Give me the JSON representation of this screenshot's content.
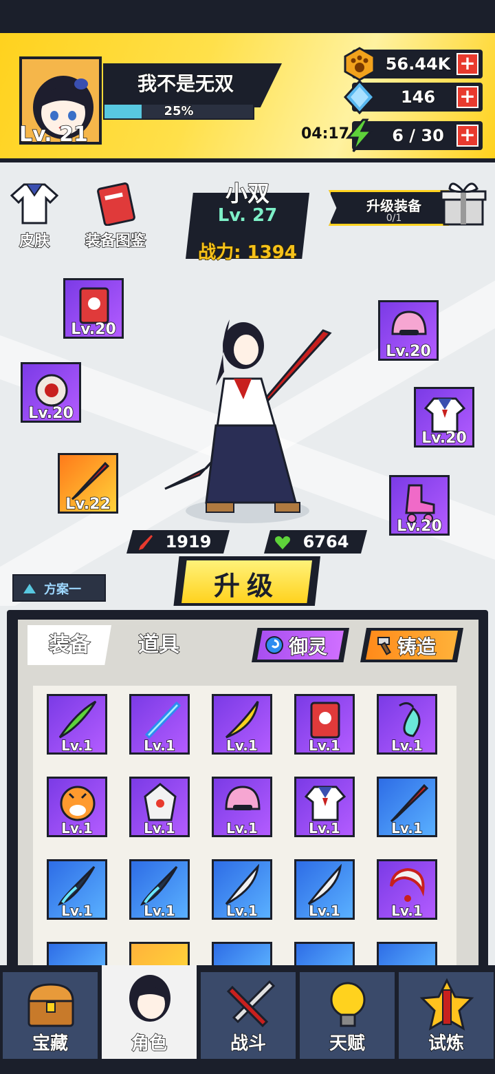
{
  "player": {
    "name": "我不是无双",
    "level": "Lv. 21",
    "exp_percent": "25%",
    "exp_fraction": 0.25
  },
  "resources": {
    "coins": "56.44K",
    "gems": "146",
    "stamina": "6 / 30",
    "stamina_timer": "04:17"
  },
  "side_buttons": {
    "skin": "皮肤",
    "codex": "装备图鉴"
  },
  "character": {
    "name": "小双",
    "level": "Lv. 27",
    "power": "战力: 1394",
    "attack": "1919",
    "hp": "6764"
  },
  "upgrade_equipment": {
    "title": "升级装备",
    "count": "0/1"
  },
  "equipped": [
    {
      "icon": "red-book-icon",
      "level": "Lv.20"
    },
    {
      "icon": "ring-icon",
      "level": "Lv.20"
    },
    {
      "icon": "red-sword-icon",
      "level": "Lv.22"
    },
    {
      "icon": "pink-helmet-icon",
      "level": "Lv.20"
    },
    {
      "icon": "uniform-icon",
      "level": "Lv.20"
    },
    {
      "icon": "roller-skate-icon",
      "level": "Lv.20"
    }
  ],
  "plan_button": "方案一",
  "levelup_button": "升级",
  "tabs": {
    "equipment": "装备",
    "items": "道具"
  },
  "actions": {
    "spirit": "御灵",
    "forge": "铸造"
  },
  "inventory": [
    {
      "icon": "green-blade-icon",
      "level": "Lv.1"
    },
    {
      "icon": "light-sword-icon",
      "level": "Lv.1"
    },
    {
      "icon": "banana-blade-icon",
      "level": "Lv.1"
    },
    {
      "icon": "red-book-icon",
      "level": "Lv.1"
    },
    {
      "icon": "jade-pendant-icon",
      "level": "Lv.1"
    },
    {
      "icon": "tiger-head-icon",
      "level": "Lv.1"
    },
    {
      "icon": "white-mask-icon",
      "level": "Lv.1"
    },
    {
      "icon": "pink-helmet-icon",
      "level": "Lv.1"
    },
    {
      "icon": "uniform-icon",
      "level": "Lv.1"
    },
    {
      "icon": "red-sword-icon",
      "level": "Lv.1"
    },
    {
      "icon": "dark-blade-icon",
      "level": "Lv.1"
    },
    {
      "icon": "dark-blade-icon",
      "level": "Lv.1"
    },
    {
      "icon": "white-blade-icon",
      "level": "Lv.1"
    },
    {
      "icon": "white-blade-icon",
      "level": "Lv.1"
    },
    {
      "icon": "crescent-ring-icon",
      "level": "Lv.1"
    }
  ],
  "nav": [
    {
      "icon": "treasure-chest-icon",
      "label": "宝藏"
    },
    {
      "icon": "character-icon",
      "label": "角色"
    },
    {
      "icon": "battle-icon",
      "label": "战斗"
    },
    {
      "icon": "lightbulb-icon",
      "label": "天赋"
    },
    {
      "icon": "trial-emblem-icon",
      "label": "试炼"
    }
  ],
  "colors": {
    "accent_yellow": "#ffd21e",
    "dark": "#1b1f2b",
    "purple_rarity": "#9b4bf2",
    "orange_rarity": "#ff8a1a",
    "blue_rarity": "#3a8cf0",
    "plus_red": "#e83a2e"
  }
}
